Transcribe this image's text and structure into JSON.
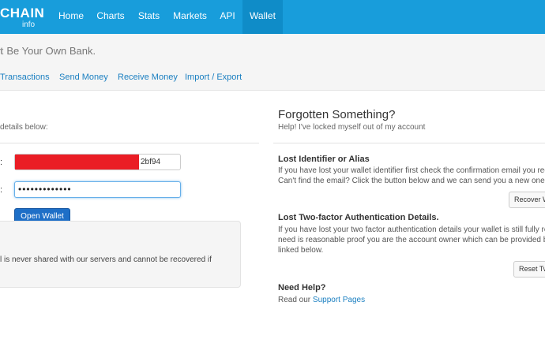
{
  "nav": {
    "logo": "CHAIN",
    "logo_sub": "info",
    "items": [
      {
        "label": "Home"
      },
      {
        "label": "Charts"
      },
      {
        "label": "Stats"
      },
      {
        "label": "Markets"
      },
      {
        "label": "API"
      },
      {
        "label": "Wallet"
      }
    ],
    "active": "Wallet"
  },
  "subheader": {
    "slogan_mark": "t",
    "slogan": "Be Your Own Bank.",
    "tabs": [
      {
        "label": "Transactions"
      },
      {
        "label": "Send Money"
      },
      {
        "label": "Receive Money"
      },
      {
        "label": "Import / Export"
      }
    ]
  },
  "login": {
    "intro": "details below:",
    "identifier_label": ":",
    "identifier_tail": "2bf94",
    "password_label": ":",
    "password_mask": "•••••••••••••",
    "open_button": "Open Wallet",
    "note": "l is never shared with our servers and cannot be recovered if"
  },
  "help": {
    "title": "Forgotten Something?",
    "subtitle": "Help! I've locked myself out of my account",
    "lost_id": {
      "title": "Lost Identifier or Alias",
      "line1": "If you have lost your wallet identifier first check the confirmation email you rece",
      "line2": "Can't find the email? Click the button below and we can send you a new one.",
      "button": "Recover W"
    },
    "lost_2fa": {
      "title": "Lost Two-factor Authentication Details.",
      "line1": "If you have lost your two factor authentication details your wallet is still fully rec",
      "line2": "need is reasonable proof you are the account owner which can be provided by",
      "line3": "linked below.",
      "button": "Reset Tw"
    },
    "need_help": {
      "title": "Need Help?",
      "prefix": "Read our ",
      "link": "Support Pages"
    }
  },
  "colors": {
    "navbar": "#189ddb",
    "nav_active": "#0f8cc8",
    "primary_button": "#1e6fc7",
    "link": "#1a7fc1",
    "redaction": "#ea1d25"
  }
}
